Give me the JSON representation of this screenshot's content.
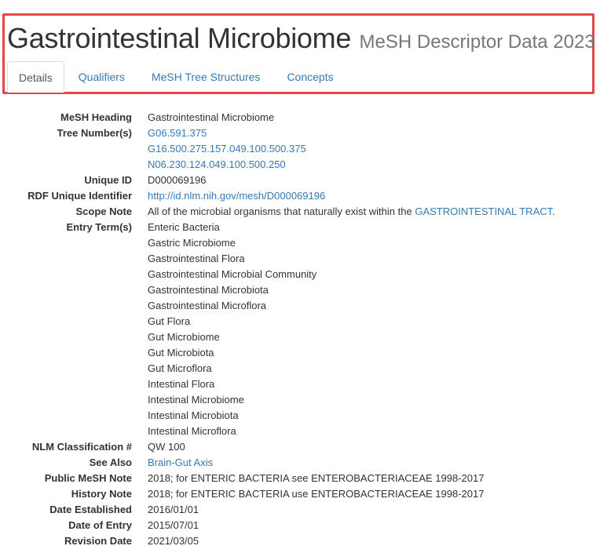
{
  "header": {
    "title": "Gastrointestinal Microbiome",
    "subtitle": "MeSH Descriptor Data 2023"
  },
  "tabs": [
    {
      "label": "Details",
      "active": true
    },
    {
      "label": "Qualifiers",
      "active": false
    },
    {
      "label": "MeSH Tree Structures",
      "active": false
    },
    {
      "label": "Concepts",
      "active": false
    }
  ],
  "details": {
    "mesh_heading": {
      "label": "MeSH Heading",
      "value": "Gastrointestinal Microbiome"
    },
    "tree_numbers": {
      "label": "Tree Number(s)",
      "values": [
        "G06.591.375",
        "G16.500.275.157.049.100.500.375",
        "N06.230.124.049.100.500.250"
      ]
    },
    "unique_id": {
      "label": "Unique ID",
      "value": "D000069196"
    },
    "rdf_id": {
      "label": "RDF Unique Identifier",
      "value": "http://id.nlm.nih.gov/mesh/D000069196"
    },
    "scope_note": {
      "label": "Scope Note",
      "text": "All of the microbial organisms that naturally exist within the ",
      "link": "GASTROINTESTINAL TRACT",
      "end": "."
    },
    "entry_terms": {
      "label": "Entry Term(s)",
      "values": [
        "Enteric Bacteria",
        "Gastric Microbiome",
        "Gastrointestinal Flora",
        "Gastrointestinal Microbial Community",
        "Gastrointestinal Microbiota",
        "Gastrointestinal Microflora",
        "Gut Flora",
        "Gut Microbiome",
        "Gut Microbiota",
        "Gut Microflora",
        "Intestinal Flora",
        "Intestinal Microbiome",
        "Intestinal Microbiota",
        "Intestinal Microflora"
      ]
    },
    "nlm_classification": {
      "label": "NLM Classification #",
      "value": "QW 100"
    },
    "see_also": {
      "label": "See Also",
      "value": "Brain-Gut Axis"
    },
    "public_mesh_note": {
      "label": "Public MeSH Note",
      "value": "2018; for ENTERIC BACTERIA see ENTEROBACTERIACEAE 1998-2017"
    },
    "history_note": {
      "label": "History Note",
      "value": "2018; for ENTERIC BACTERIA use ENTEROBACTERIACEAE 1998-2017"
    },
    "date_established": {
      "label": "Date Established",
      "value": "2016/01/01"
    },
    "date_of_entry": {
      "label": "Date of Entry",
      "value": "2015/07/01"
    },
    "revision_date": {
      "label": "Revision Date",
      "value": "2021/03/05"
    }
  },
  "colors": {
    "link": "#337ab7",
    "highlight_border": "#e8454a",
    "subtitle": "#777777",
    "text": "#333333"
  }
}
